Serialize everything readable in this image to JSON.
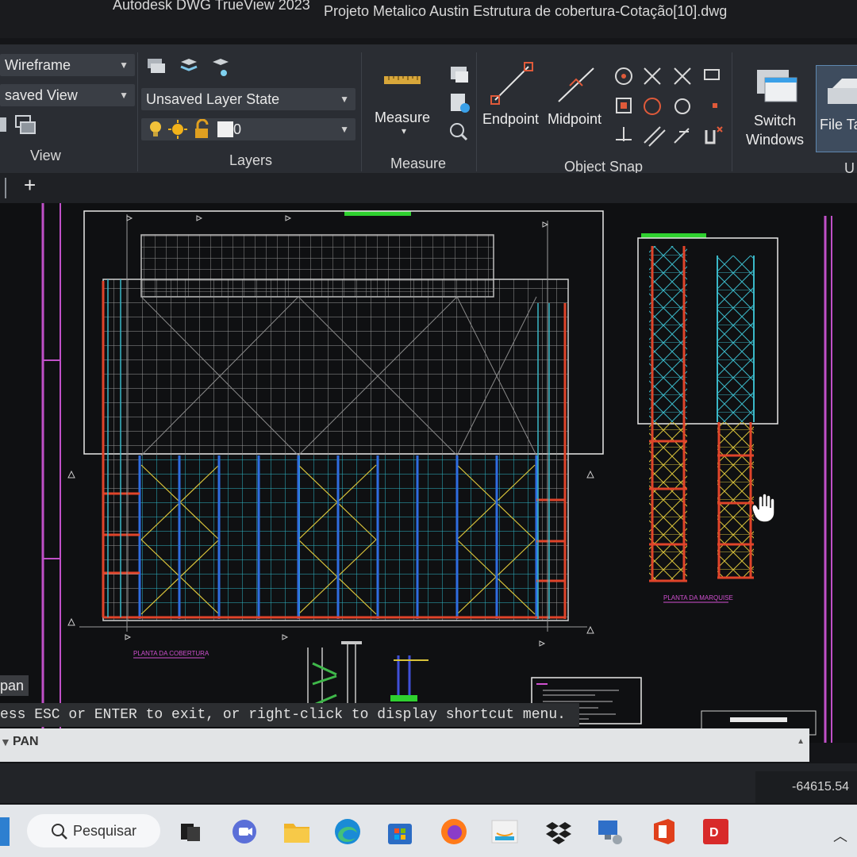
{
  "window": {
    "app_title": "Autodesk DWG TrueView 2023",
    "file_title": "Projeto Metalico Austin Estrutura de cobertura-Cotação[10].dwg"
  },
  "ribbon": {
    "view": {
      "visual_style": "Wireframe",
      "saved_view": "saved View",
      "label": "View"
    },
    "layers": {
      "layer_state": "Unsaved Layer State",
      "current_layer": "0",
      "label": "Layers"
    },
    "measure": {
      "button_label": "Measure",
      "label": "Measure"
    },
    "object_snap": {
      "endpoint_label": "Endpoint",
      "midpoint_label": "Midpoint",
      "label": "Object Snap"
    },
    "switch_windows": "Switch\nWindows",
    "file_tabs": "File Ta",
    "user_interface_partial": "U"
  },
  "tabs": {
    "add_glyph": "+"
  },
  "drawing": {
    "plan_cobertura_label": "PLANTA DA COBERTURA",
    "plan_marquise_label": "PLANTA DA MARQUISE"
  },
  "command": {
    "pan_tooltip": "pan",
    "hint": "ess ESC or ENTER to exit, or right-click to display shortcut menu.",
    "current": "PAN"
  },
  "status": {
    "coordinates": "-64615.54"
  },
  "taskbar": {
    "search_label": "Pesquisar",
    "apps": [
      "task-view",
      "meet",
      "file-explorer",
      "edge",
      "store",
      "firefox",
      "amazon",
      "dropbox",
      "network",
      "office",
      "dwg-trueview"
    ]
  },
  "colors": {
    "ribbon_bg": "#2a2d33",
    "canvas_bg": "#0f1012",
    "accent_blue": "#3aa0e8",
    "magenta_line": "#c050c8",
    "green_bar": "#2fd12f",
    "red_member": "#e0442a",
    "cyan_member": "#36b6c8",
    "yellow_brace": "#d8c23a"
  }
}
